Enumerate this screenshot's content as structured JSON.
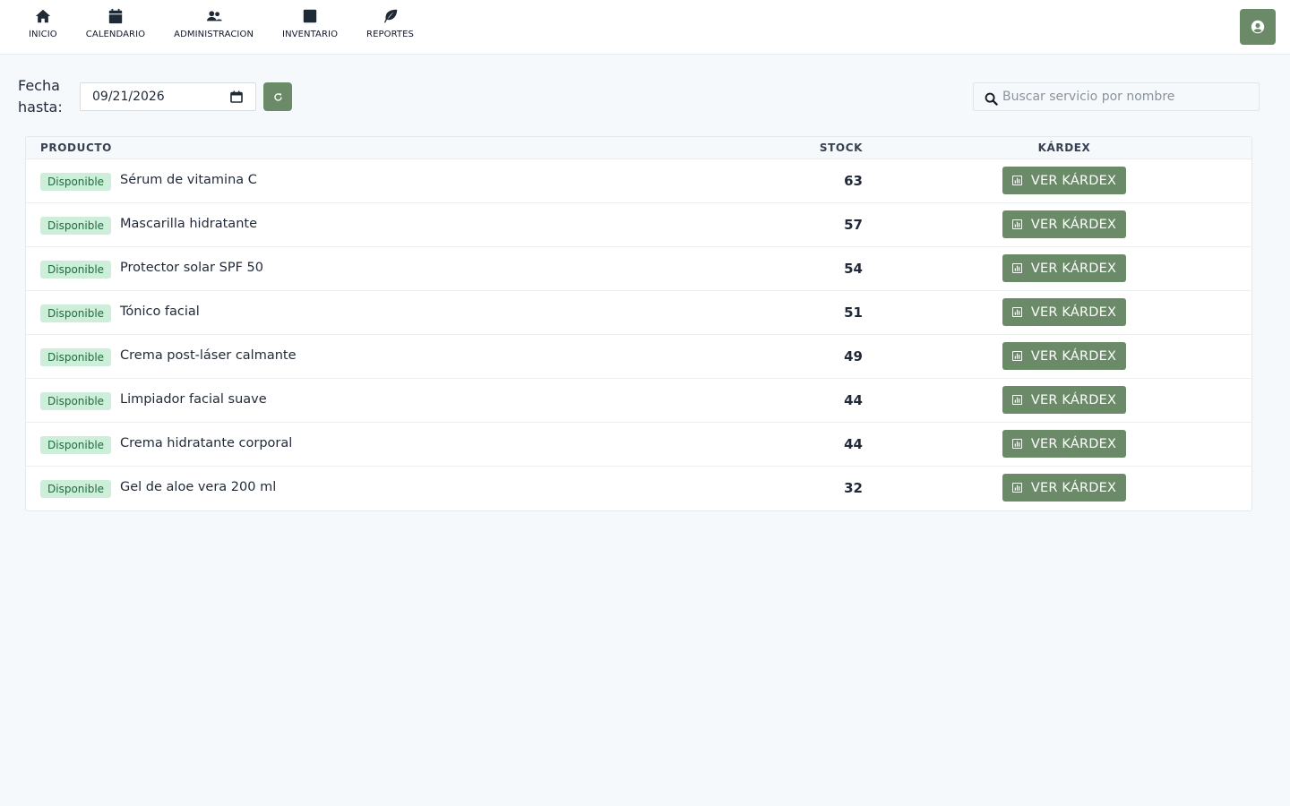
{
  "nav": {
    "items": [
      {
        "label": "INICIO",
        "icon": "home-icon"
      },
      {
        "label": "CALENDARIO",
        "icon": "calendar-icon"
      },
      {
        "label": "ADMINISTRACION",
        "icon": "users-icon"
      },
      {
        "label": "INVENTARIO",
        "icon": "box-icon"
      },
      {
        "label": "REPORTES",
        "icon": "leaf-icon"
      }
    ],
    "user_icon": "user-circle-icon"
  },
  "filter": {
    "label": "Fecha hasta:",
    "date_value": "09/21/2026",
    "refresh_icon": "refresh-icon"
  },
  "search": {
    "placeholder": "Buscar servicio por nombre",
    "value": ""
  },
  "table": {
    "headers": {
      "product": "PRODUCTO",
      "stock": "STOCK",
      "kardex": "KÁRDEX"
    },
    "rows": [
      {
        "status": "Disponible",
        "name": "Sérum de vitamina C",
        "stock": "63",
        "action": "VER KÁRDEX"
      },
      {
        "status": "Disponible",
        "name": "Mascarilla hidratante",
        "stock": "57",
        "action": "VER KÁRDEX"
      },
      {
        "status": "Disponible",
        "name": "Protector solar SPF 50",
        "stock": "54",
        "action": "VER KÁRDEX"
      },
      {
        "status": "Disponible",
        "name": "Tónico facial",
        "stock": "51",
        "action": "VER KÁRDEX"
      },
      {
        "status": "Disponible",
        "name": "Crema post-láser calmante",
        "stock": "49",
        "action": "VER KÁRDEX"
      },
      {
        "status": "Disponible",
        "name": "Limpiador facial suave",
        "stock": "44",
        "action": "VER KÁRDEX"
      },
      {
        "status": "Disponible",
        "name": "Crema hidratante corporal",
        "stock": "44",
        "action": "VER KÁRDEX"
      },
      {
        "status": "Disponible",
        "name": "Gel de aloe vera 200 ml",
        "stock": "32",
        "action": "VER KÁRDEX"
      }
    ]
  },
  "colors": {
    "accent": "#6a8a68",
    "badge_bg": "#cdeed9",
    "badge_text": "#1f6b3e",
    "page_bg": "#f6f9fb"
  }
}
